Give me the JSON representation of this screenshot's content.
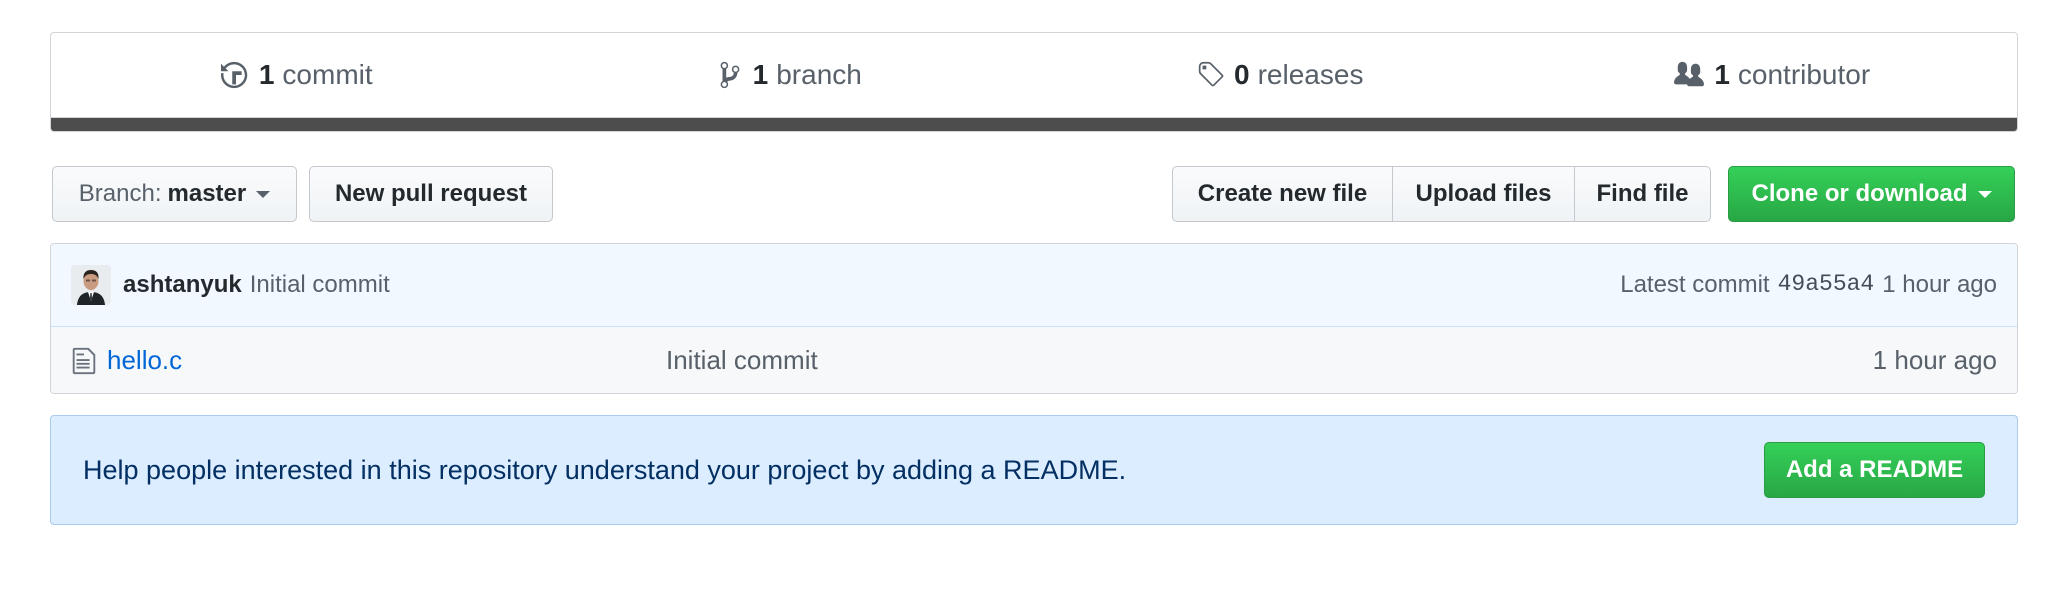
{
  "summary": {
    "commits": {
      "count": "1",
      "label": "commit",
      "icon": "history-icon"
    },
    "branches": {
      "count": "1",
      "label": "branch",
      "icon": "git-branch-icon"
    },
    "releases": {
      "count": "0",
      "label": "releases",
      "icon": "tag-icon"
    },
    "contributors": {
      "count": "1",
      "label": "contributor",
      "icon": "people-icon"
    },
    "language_bar_color": "#4d4d4d"
  },
  "toolbar": {
    "branch_prefix": "Branch:",
    "branch_name": "master",
    "new_pull_request": "New pull request",
    "create_new_file": "Create new file",
    "upload_files": "Upload files",
    "find_file": "Find file",
    "clone_or_download": "Clone or download"
  },
  "latest_commit": {
    "author": "ashtanyuk",
    "message": "Initial commit",
    "prefix": "Latest commit",
    "sha": "49a55a4",
    "age": "1 hour ago"
  },
  "files": [
    {
      "name": "hello.c",
      "message": "Initial commit",
      "age": "1 hour ago",
      "icon": "file-icon"
    }
  ],
  "readme_prompt": {
    "text": "Help people interested in this repository understand your project by adding a README.",
    "button": "Add a README"
  },
  "colors": {
    "accent_green": "#28a745",
    "link_blue": "#0366d6",
    "info_bg": "#dbedff"
  }
}
